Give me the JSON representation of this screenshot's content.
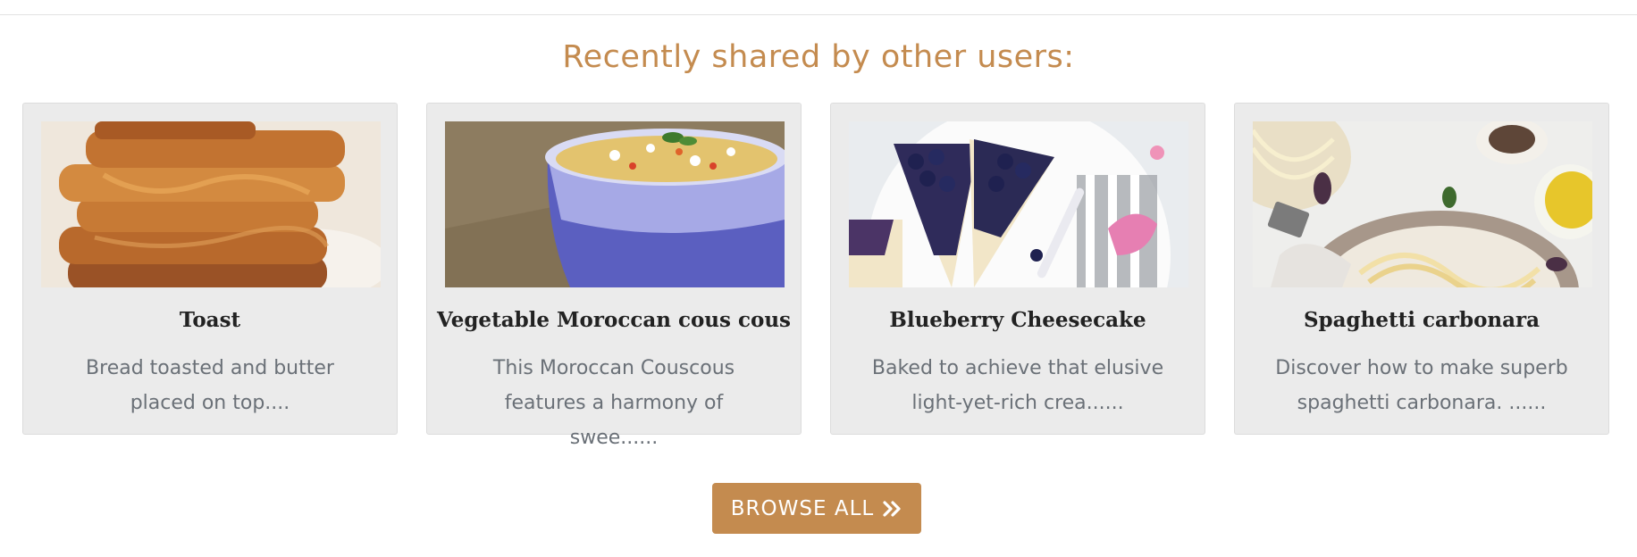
{
  "heading": "Recently shared by other users:",
  "recipes": [
    {
      "title": "Toast",
      "description": "Bread toasted and butter placed on top....",
      "image_icon": "toast-image"
    },
    {
      "title": "Vegetable Moroccan cous cous",
      "description": "This Moroccan Couscous features a harmony of swee......",
      "image_icon": "couscous-image"
    },
    {
      "title": "Blueberry Cheesecake",
      "description": "Baked to achieve that elusive light-yet-rich crea......",
      "image_icon": "cheesecake-image"
    },
    {
      "title": "Spaghetti carbonara",
      "description": "Discover how to make superb spaghetti carbonara. ......",
      "image_icon": "carbonara-image"
    }
  ],
  "browse_button": {
    "label": "BROWSE ALL",
    "icon": "double-chevron-right-icon"
  },
  "colors": {
    "accent": "#c48b4f",
    "card_background": "#ebebeb",
    "title_text": "#222222",
    "description_text": "#6a7077"
  }
}
